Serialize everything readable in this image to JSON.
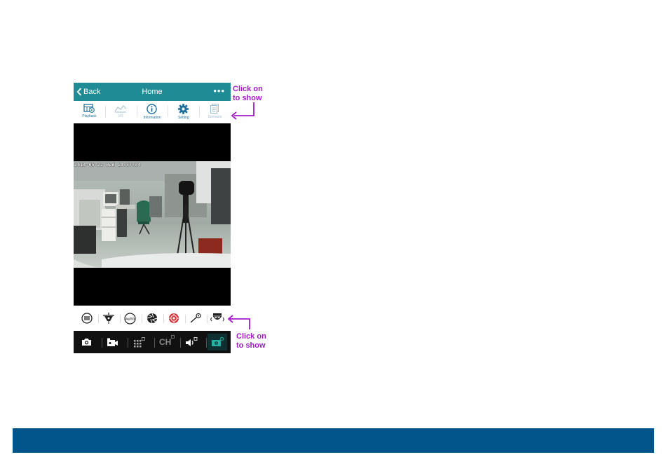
{
  "nav": {
    "back_label": "Back",
    "title": "Home",
    "more_label": "•••"
  },
  "toolbar": {
    "items": [
      {
        "label": "Playback",
        "icon": "playback-icon"
      },
      {
        "label": "I/O",
        "icon": "chart-icon"
      },
      {
        "label": "Information",
        "icon": "info-icon"
      },
      {
        "label": "Setting",
        "icon": "gear-icon"
      },
      {
        "label": "Scenario",
        "icon": "document-icon"
      }
    ]
  },
  "video": {
    "timestamp": "2014-05-22 Wed 10:37:34"
  },
  "ptz_bar": {
    "items": [
      "menu-icon",
      "focus-icon",
      "auto-iris-icon",
      "iris-icon",
      "lens-icon",
      "zoom-icon",
      "dome-icon"
    ]
  },
  "bottom_bar": {
    "items": [
      "snapshot-icon",
      "record-icon",
      "grid-icon",
      "channel-icon",
      "audio-icon",
      "ptz-camera-icon"
    ],
    "channel_label": "CH",
    "auto_iris_label": "AUTO"
  },
  "annotations": {
    "top": {
      "line1": "Click on",
      "line2": "to show"
    },
    "bottom": {
      "line1": "Click on",
      "line2": "to show"
    }
  },
  "colors": {
    "nav": "#1f8b95",
    "icon_blue": "#1f6f9a",
    "annotation": "#a21ac8",
    "footer": "#02558a",
    "active": "#27b0a4"
  }
}
